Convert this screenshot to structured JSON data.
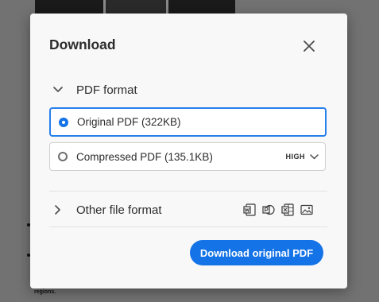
{
  "dialog": {
    "title": "Download",
    "close_icon": "close-icon",
    "pdf_section": {
      "label": "PDF format",
      "expanded": true
    },
    "options": [
      {
        "label": "Original PDF (322KB)",
        "selected": true
      },
      {
        "label": "Compressed PDF (135.1KB)",
        "selected": false,
        "quality": "HIGH"
      }
    ],
    "other_section": {
      "label": "Other file format",
      "expanded": false,
      "format_icons": [
        "word-icon",
        "powerpoint-icon",
        "excel-icon",
        "image-icon"
      ]
    },
    "download_button": "Download original PDF"
  },
  "background": {
    "footer_text": "regions."
  },
  "colors": {
    "accent": "#1473e6",
    "selected_border": "#2680eb",
    "dialog_bg": "#f8f8f8",
    "overlay": "#6f6f6f"
  }
}
